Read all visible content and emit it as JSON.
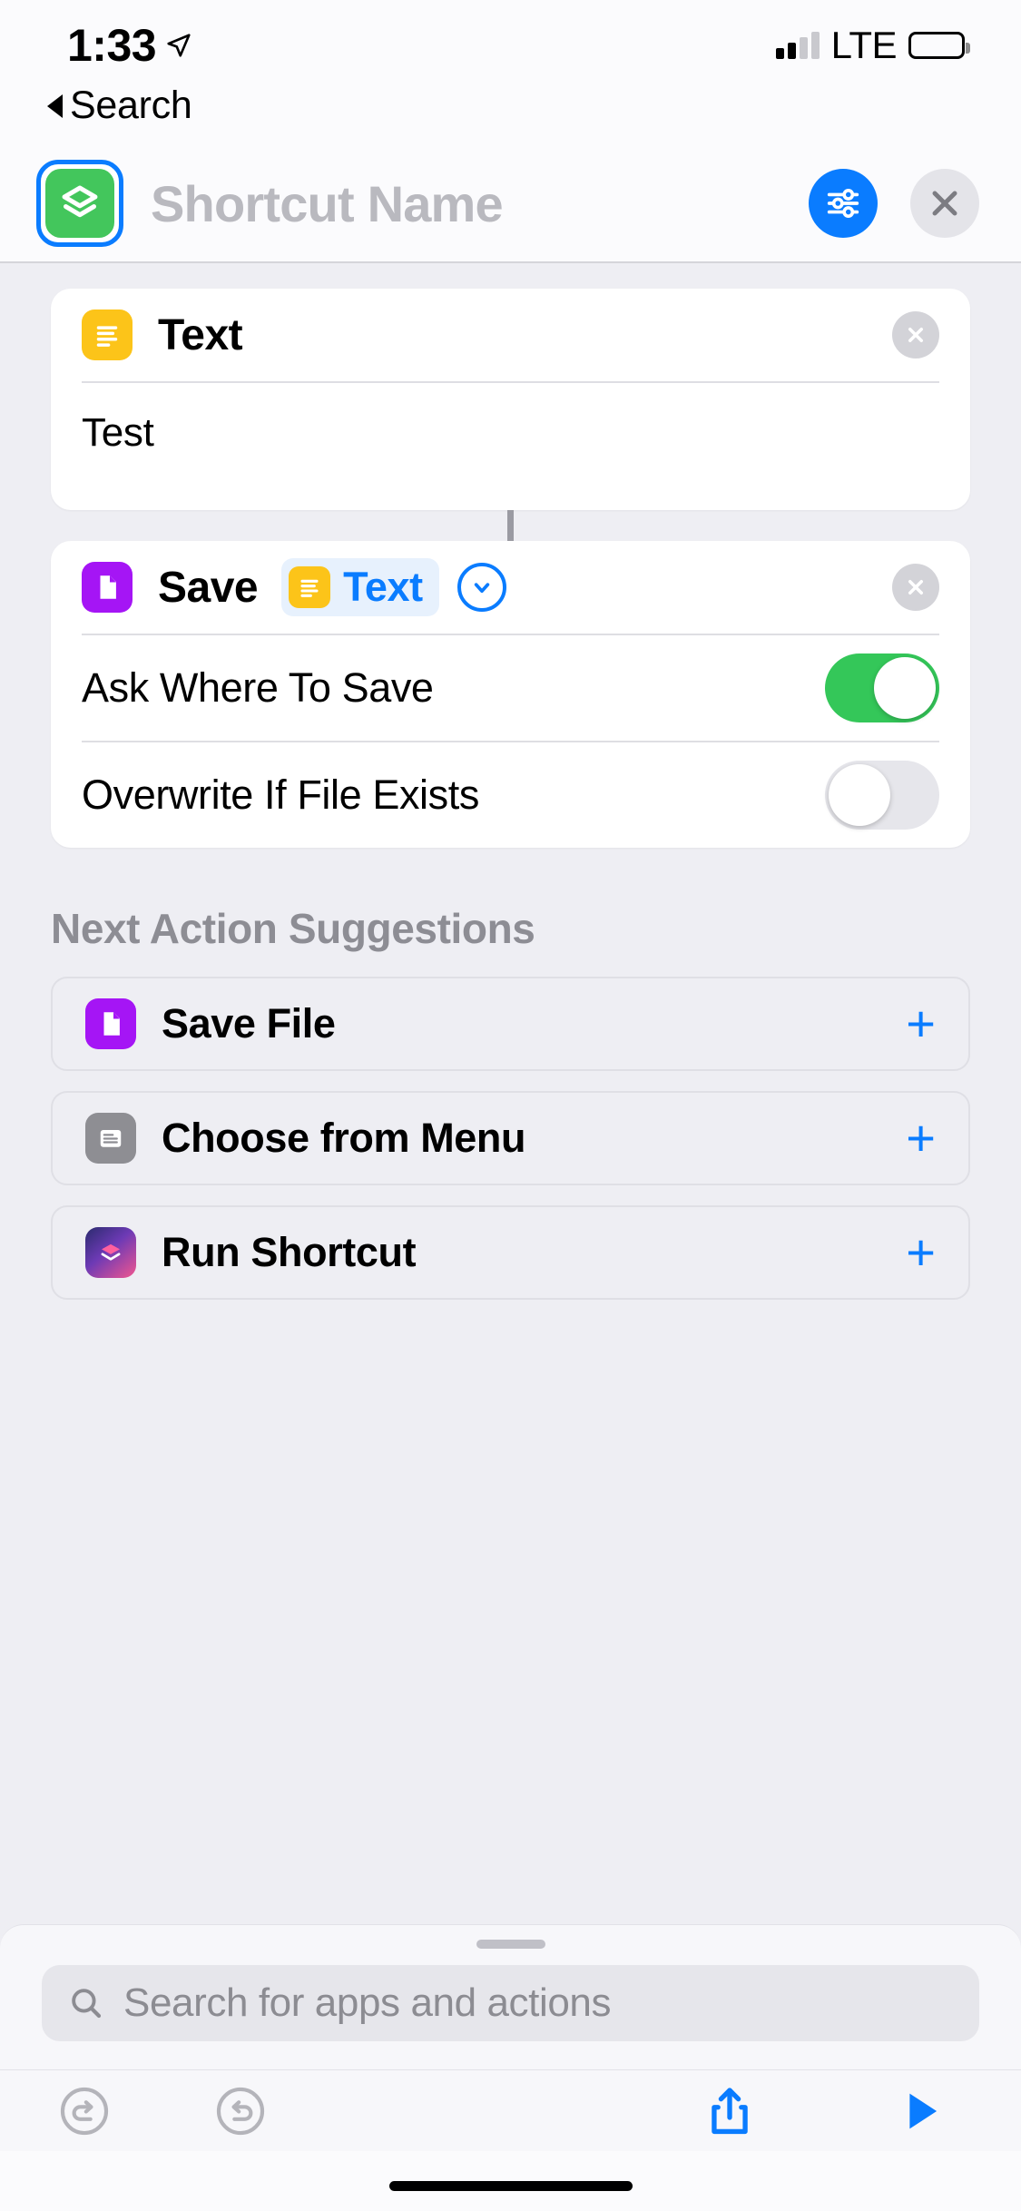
{
  "status_bar": {
    "time": "1:33",
    "location_icon": "location-arrow-icon",
    "carrier_label": "LTE",
    "signal_bars_active": 2,
    "signal_bars_total": 4,
    "battery_level_percent": 80
  },
  "back_nav": {
    "label": "Search",
    "icon": "back-triangle-icon"
  },
  "header": {
    "shortcut_icon": "shortcuts-glyph-icon",
    "shortcut_icon_color": "#43c65c",
    "selection_ring_color": "#0a7cff",
    "title_placeholder": "Shortcut Name",
    "settings_button_icon": "sliders-icon",
    "settings_button_color": "#0a7cff",
    "close_button_icon": "close-x-icon"
  },
  "actions": [
    {
      "id": "text-action",
      "icon": "text-lines-icon",
      "icon_color": "#fcc419",
      "title": "Text",
      "delete_icon": "close-x-circle-icon",
      "value": "Test"
    },
    {
      "id": "save-action",
      "icon": "document-icon",
      "icon_color": "#a515f5",
      "title": "Save",
      "token": {
        "icon": "text-lines-icon",
        "icon_color": "#fcc419",
        "label": "Text"
      },
      "chevron_icon": "chevron-down-circle-icon",
      "delete_icon": "close-x-circle-icon",
      "options": [
        {
          "label": "Ask Where To Save",
          "enabled": true
        },
        {
          "label": "Overwrite If File Exists",
          "enabled": false
        }
      ]
    }
  ],
  "suggestions": {
    "title": "Next Action Suggestions",
    "items": [
      {
        "label": "Save File",
        "icon": "document-icon",
        "icon_color": "#a515f5",
        "add_icon": "plus-icon",
        "add_label": "+"
      },
      {
        "label": "Choose from Menu",
        "icon": "menu-list-icon",
        "icon_color": "#8e8e93",
        "add_icon": "plus-icon",
        "add_label": "+"
      },
      {
        "label": "Run Shortcut",
        "icon": "shortcuts-app-icon",
        "icon_color": "#6d3ab5",
        "add_icon": "plus-icon",
        "add_label": "+"
      }
    ]
  },
  "search": {
    "placeholder": "Search for apps and actions",
    "icon": "search-icon"
  },
  "toolbar": {
    "undo_icon": "undo-arrow-icon",
    "redo_icon": "redo-arrow-icon",
    "share_icon": "share-up-icon",
    "play_icon": "play-triangle-icon",
    "accent_color": "#0a7cff"
  }
}
